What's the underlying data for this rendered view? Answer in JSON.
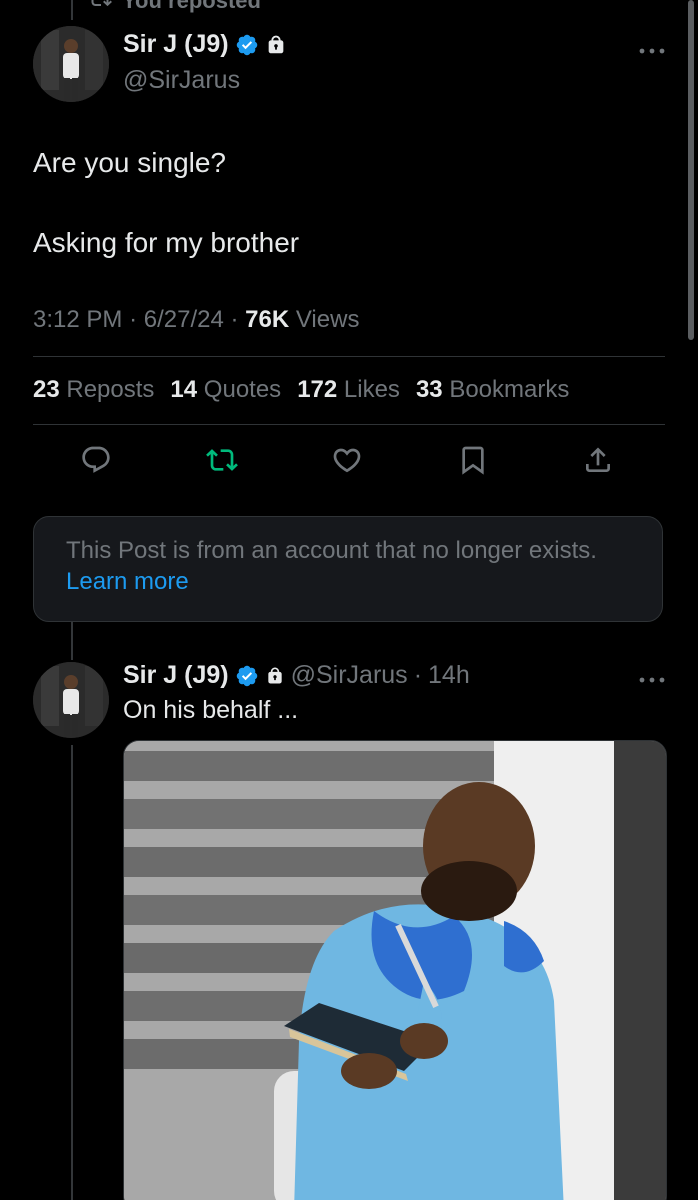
{
  "reposted_label": "You reposted",
  "main_post": {
    "display_name": "Sir J (J9)",
    "handle": "@SirJarus",
    "text_line1": "Are you single?",
    "text_line2": "Asking for my brother",
    "time": "3:12 PM",
    "date": "6/27/24",
    "views_count": "76K",
    "views_label": "Views"
  },
  "stats": {
    "reposts_count": "23",
    "reposts_label": "Reposts",
    "quotes_count": "14",
    "quotes_label": "Quotes",
    "likes_count": "172",
    "likes_label": "Likes",
    "bookmarks_count": "33",
    "bookmarks_label": "Bookmarks"
  },
  "actions": {
    "reply_icon": "reply-icon",
    "repost_icon": "repost-icon",
    "like_icon": "heart-icon",
    "bookmark_icon": "bookmark-icon",
    "share_icon": "share-icon",
    "repost_color": "#00ba7c"
  },
  "notice": {
    "text": "This Post is from an account that no longer exists.",
    "link": "Learn more"
  },
  "reply": {
    "display_name": "Sir J (J9)",
    "handle": "@SirJarus",
    "separator": "·",
    "time_ago": "14h",
    "text": "On his behalf ..."
  },
  "colors": {
    "background": "#000000",
    "accent": "#1d9bf0",
    "text_primary": "#e7e9ea",
    "text_secondary": "#71767b"
  }
}
